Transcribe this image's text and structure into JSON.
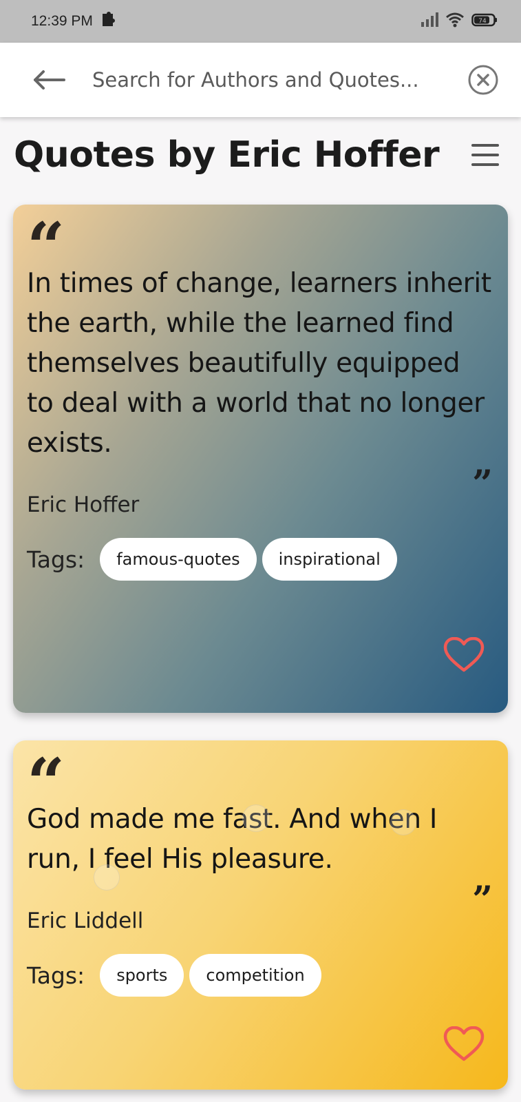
{
  "status_bar": {
    "time": "12:39 PM",
    "battery": "74"
  },
  "search": {
    "placeholder": "Search for Authors and Quotes..."
  },
  "page": {
    "title": "Quotes by Eric Hoffer"
  },
  "quotes": [
    {
      "open_mark": "“",
      "text": "In times of change, learners inherit the earth, while the learned find themselves beautifully equipped to deal with a world that no longer exists.",
      "close_mark": "”",
      "author": "Eric Hoffer",
      "tags_label": "Tags:",
      "tags": [
        "famous-quotes",
        "inspirational"
      ]
    },
    {
      "open_mark": "“",
      "text": "God made me fast. And when I run, I feel His pleasure.",
      "close_mark": "”",
      "author": "Eric Liddell",
      "tags_label": "Tags:",
      "tags": [
        "sports",
        "competition"
      ]
    }
  ],
  "colors": {
    "heart": "#f05a55",
    "card1_gradient": [
      "#f3cf98",
      "#275a80"
    ],
    "card2_gradient": [
      "#fbe4a8",
      "#f6b81c"
    ]
  },
  "icons": {
    "back": "arrow-left-icon",
    "clear": "close-circle-icon",
    "menu": "hamburger-menu-icon",
    "favorite": "heart-outline-icon"
  }
}
